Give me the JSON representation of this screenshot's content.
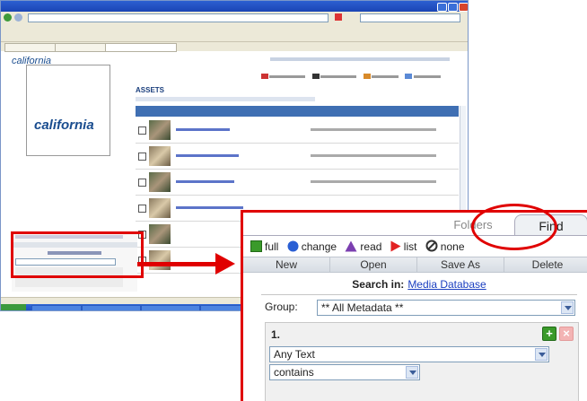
{
  "browser": {
    "title": "",
    "url": "",
    "tabs": [],
    "status_text": ""
  },
  "app": {
    "logo": "california",
    "logo_tagline": "",
    "section_heading": "ASSETS",
    "grid_header": "",
    "rows": []
  },
  "find_panel": {
    "tabs": [
      {
        "label": "Folders",
        "active": false
      },
      {
        "label": "Find",
        "active": true
      }
    ],
    "permissions": [
      {
        "label": "full",
        "color": "#3a9a2a",
        "icon": "green-square-icon"
      },
      {
        "label": "change",
        "color": "#2a5fd4",
        "icon": "blue-circle-icon"
      },
      {
        "label": "read",
        "color": "#7b3fb0",
        "icon": "purple-triangle-icon"
      },
      {
        "label": "list",
        "color": "#e22222",
        "icon": "red-play-icon"
      },
      {
        "label": "none",
        "color": "#333333",
        "icon": "circle-slash-icon"
      }
    ],
    "buttons": [
      "New",
      "Open",
      "Save As",
      "Delete"
    ],
    "search_in_label": "Search in:",
    "search_in_link": "Media Database",
    "group_label": "Group:",
    "group_value": "** All Metadata **",
    "criteria": {
      "number": "1.",
      "field_value": "Any Text",
      "operator_value": "contains"
    }
  },
  "colors": {
    "highlight": "#e00000",
    "link": "#1a3ec0",
    "add_button": "#3a9a2a",
    "remove_button": "#f0a0a0"
  }
}
